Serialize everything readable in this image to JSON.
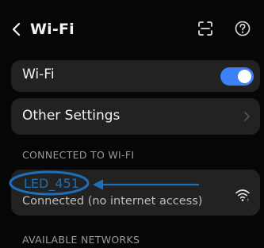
{
  "header": {
    "title": "Wi-Fi",
    "back_icon": "chevron-left-icon",
    "scan_icon": "scan-icon",
    "help_icon": "help-icon"
  },
  "wifi_toggle": {
    "label": "Wi-Fi",
    "enabled": true,
    "accent_color": "#3b82f6"
  },
  "other_settings": {
    "label": "Other Settings",
    "chevron_icon": "chevron-right-icon"
  },
  "connected_section": {
    "label": "CONNECTED TO WI-FI",
    "network": {
      "ssid": "LED_451",
      "status": "Connected (no internet access)",
      "signal_icon": "wifi-signal-icon",
      "ssid_color": "#1e6fb8"
    }
  },
  "available_section": {
    "label": "AVAILABLE NETWORKS"
  },
  "annotation": {
    "highlight_color": "#1e6fb8",
    "shapes": [
      "ellipse",
      "arrow"
    ]
  }
}
